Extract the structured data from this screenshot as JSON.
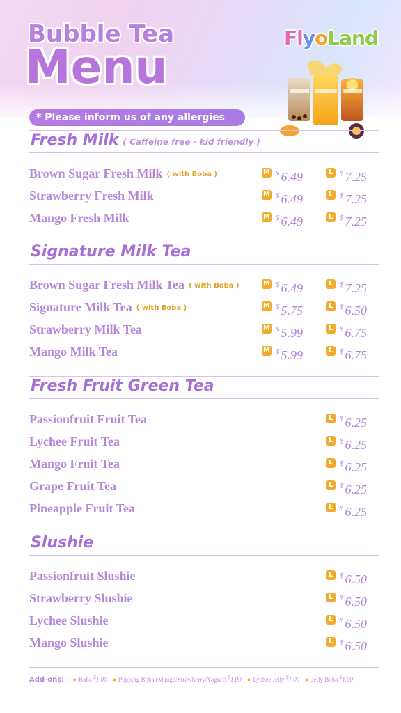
{
  "header": {
    "title_line1": "Bubble Tea",
    "title_line2": "Menu",
    "logo_parts": [
      "Fl",
      "y",
      "o",
      "Land"
    ],
    "allergy_note": "* Please inform us of any allergies"
  },
  "sections": [
    {
      "title": "Fresh Milk",
      "subtitle": "( Caffeine free - kid friendly )",
      "items": [
        {
          "name": "Brown Sugar Fresh Milk",
          "tag": "( with Boba )",
          "m": "6.49",
          "l": "7.25"
        },
        {
          "name": "Strawberry Fresh Milk",
          "tag": "",
          "m": "6.49",
          "l": "7.25"
        },
        {
          "name": "Mango Fresh Milk",
          "tag": "",
          "m": "6.49",
          "l": "7.25"
        }
      ]
    },
    {
      "title": "Signature Milk Tea",
      "subtitle": "",
      "items": [
        {
          "name": "Brown Sugar Fresh Milk Tea",
          "tag": "( with Boba )",
          "m": "6.49",
          "l": "7.25"
        },
        {
          "name": "Signature Milk Tea",
          "tag": "( with Boba )",
          "m": "5.75",
          "l": "6.50"
        },
        {
          "name": "Strawberry Milk Tea",
          "tag": "",
          "m": "5.99",
          "l": "6.75"
        },
        {
          "name": "Mango Milk Tea",
          "tag": "",
          "m": "5.99",
          "l": "6.75"
        }
      ]
    },
    {
      "title": "Fresh Fruit Green Tea",
      "subtitle": "",
      "items": [
        {
          "name": "Passionfruit Fruit Tea",
          "tag": "",
          "m": "",
          "l": "6.25"
        },
        {
          "name": "Lychee Fruit Tea",
          "tag": "",
          "m": "",
          "l": "6.25"
        },
        {
          "name": "Mango Fruit Tea",
          "tag": "",
          "m": "",
          "l": "6.25"
        },
        {
          "name": "Grape Fruit Tea",
          "tag": "",
          "m": "",
          "l": "6.25"
        },
        {
          "name": "Pineapple Fruit Tea",
          "tag": "",
          "m": "",
          "l": "6.25"
        }
      ]
    },
    {
      "title": "Slushie",
      "subtitle": "",
      "items": [
        {
          "name": "Passionfruit Slushie",
          "tag": "",
          "m": "",
          "l": "6.50"
        },
        {
          "name": "Strawberry Slushie",
          "tag": "",
          "m": "",
          "l": "6.50"
        },
        {
          "name": "Lychee Slushie",
          "tag": "",
          "m": "",
          "l": "6.50"
        },
        {
          "name": "Mango Slushie",
          "tag": "",
          "m": "",
          "l": "6.50"
        }
      ]
    }
  ],
  "size_labels": {
    "m": "M",
    "l": "L"
  },
  "currency": "$",
  "addons": {
    "label": "Add-ons:",
    "items": [
      {
        "name": "Boba",
        "price": "1.00"
      },
      {
        "name": "Popping Boba (Mango/Strawberry/Yogurt)",
        "price": "1.00"
      },
      {
        "name": "Lychee Jelly",
        "price": "1.00"
      },
      {
        "name": "Jelly Boba",
        "price": "1.00"
      }
    ]
  },
  "colors": {
    "accent": "#b487db",
    "badge": "#f0ad2d",
    "heading": "#a66fd6"
  }
}
